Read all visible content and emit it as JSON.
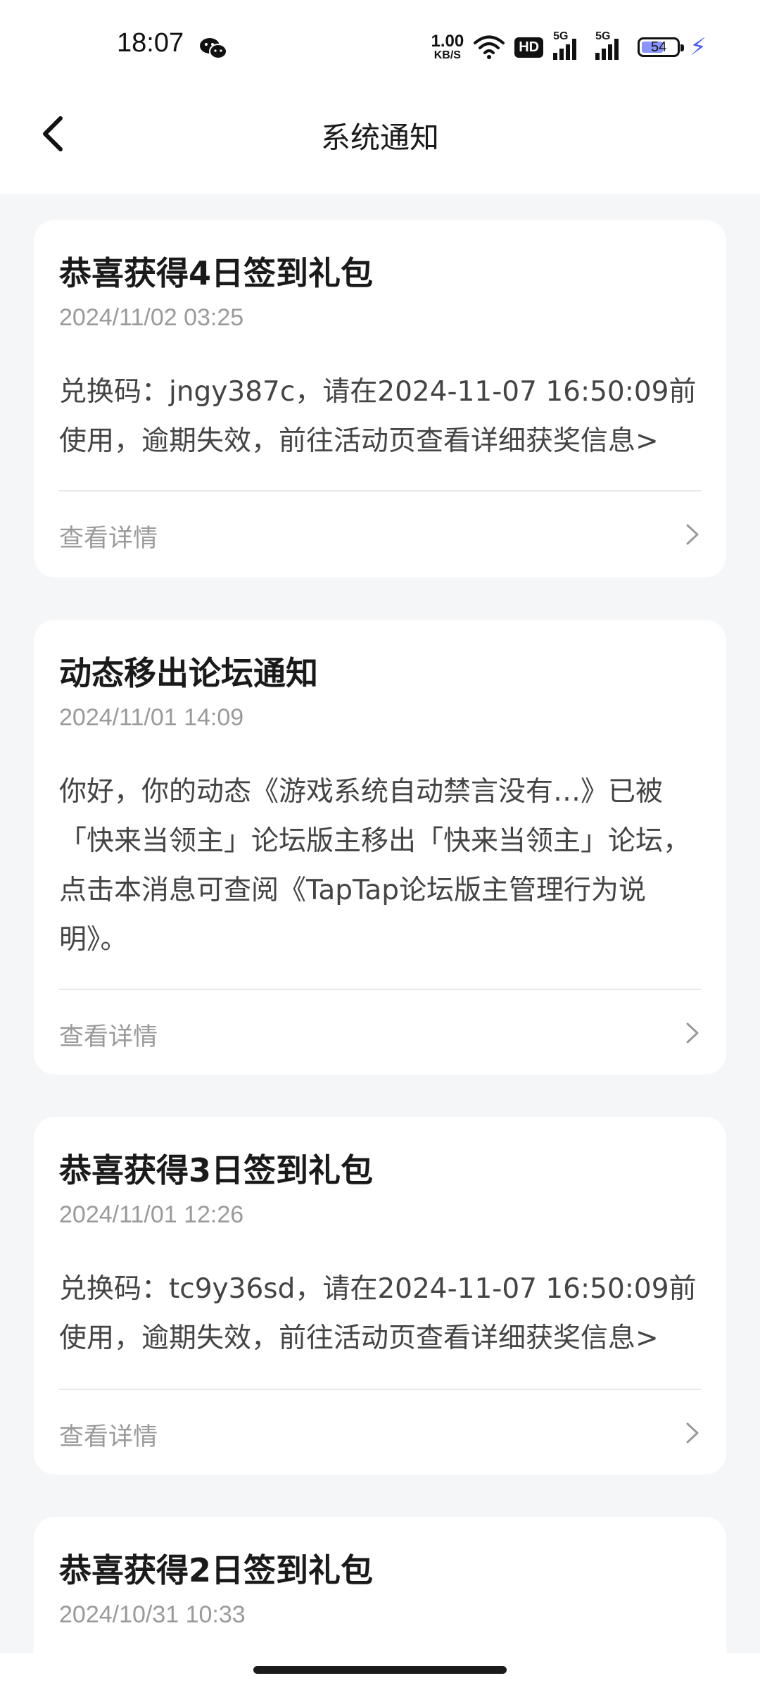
{
  "status_bar": {
    "time": "18:07",
    "net_speed_value": "1.00",
    "net_speed_unit": "KB/S",
    "hd_label": "HD",
    "signal_1_label": "5G",
    "signal_2_label": "5G",
    "battery_level": "54"
  },
  "header": {
    "title": "系统通知"
  },
  "notifications": [
    {
      "title": "恭喜获得4日签到礼包",
      "date": "2024/11/02 03:25",
      "body": "兑换码：jngy387c，请在2024-11-07 16:50:09前使用，逾期失效，前往活动页查看详细获奖信息>",
      "detail_label": "查看详情"
    },
    {
      "title": "动态移出论坛通知",
      "date": "2024/11/01 14:09",
      "body": "你好，你的动态《游戏系统自动禁言没有…》已被「快来当领主」论坛版主移出「快来当领主」论坛，点击本消息可查阅《TapTap论坛版主管理行为说明》。",
      "detail_label": "查看详情"
    },
    {
      "title": "恭喜获得3日签到礼包",
      "date": "2024/11/01 12:26",
      "body": "兑换码：tc9y36sd，请在2024-11-07 16:50:09前使用，逾期失效，前往活动页查看详细获奖信息>",
      "detail_label": "查看详情"
    },
    {
      "title": "恭喜获得2日签到礼包",
      "date": "2024/10/31 10:33"
    }
  ]
}
